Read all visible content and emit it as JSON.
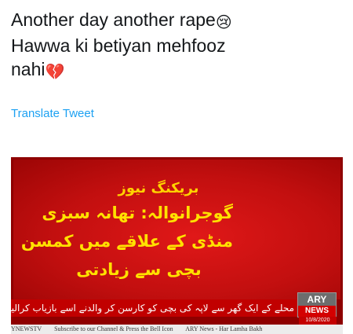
{
  "tweet": {
    "line1": "Another day another rape",
    "emoji1": "😢",
    "line2": "Hawwa ki betiyan mehfooz",
    "line3": "nahi",
    "emoji2": "💔",
    "translate_label": "Translate Tweet"
  },
  "media": {
    "breaking_label": "بریکنگ نیوز",
    "headline_lines": [
      "گوجرانوالہ: تھانہ سبزی",
      "منڈی کے علاقے میں کمسن",
      "بچی سے زیادتی"
    ],
    "ticker": "محلے کے ایک گھر سے لاپہ کی بچی کو کارسن کر والدنے اسے بازیاب کرالیا",
    "logo_top": "ARY",
    "logo_bottom": "NEWS",
    "date": "10/8/2020",
    "strip": [
      "YNEWSTV",
      "Subscribe to our Channel & Press the Bell Icon",
      "ARY News - Har Lamha Bakh"
    ]
  }
}
